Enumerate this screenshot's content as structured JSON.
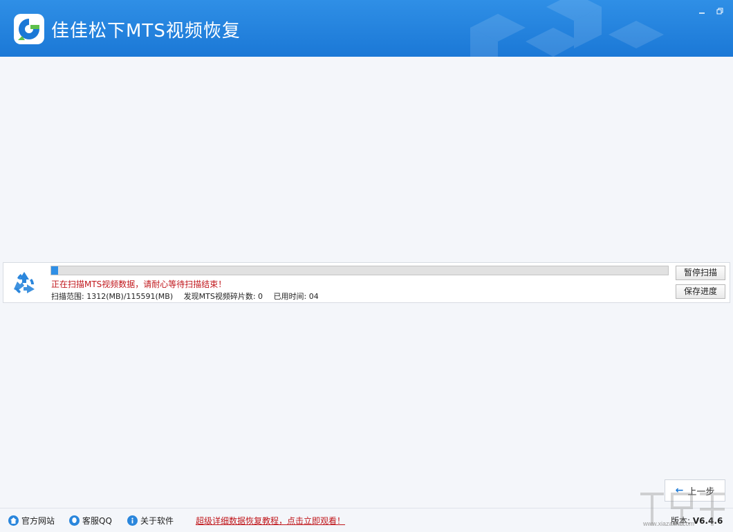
{
  "app": {
    "title": "佳佳松下MTS视频恢复",
    "window_controls": [
      "minimize-icon",
      "restore-icon"
    ],
    "accent": "#1b78d6"
  },
  "scan": {
    "progress": 0.0113,
    "status": "正在扫描MTS视频数据，请耐心等待扫描结束！",
    "range": "扫描范围: 1312(MB)/115591(MB)",
    "fragments": "发现MTS视频碎片数: 0",
    "elapsed": "已用时间: 04",
    "pause_label": "暂停扫描",
    "save_label": "保存进度",
    "status_color": "#c0161b"
  },
  "nav": {
    "back_label": "上一步"
  },
  "footer": {
    "links": [
      {
        "label": "官方网站",
        "icon": "home-icon"
      },
      {
        "label": "客服QQ",
        "icon": "qq-icon"
      },
      {
        "label": "关于软件",
        "icon": "info-icon"
      }
    ],
    "promo": "超级详细数据恢复教程，点击立即观看！",
    "version_label": "版本: ",
    "version": "V6.4.6"
  },
  "watermark": {
    "text": "www.xiazaiba.com"
  }
}
